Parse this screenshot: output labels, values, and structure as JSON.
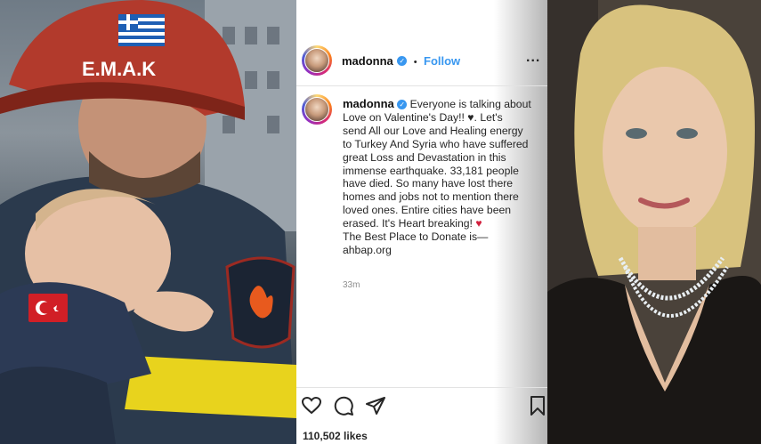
{
  "post_header": {
    "username": "madonna",
    "separator": "•",
    "follow_label": "Follow",
    "more_label": "..."
  },
  "caption": {
    "username": "madonna",
    "line1": "Everyone is talking about",
    "line2": "Love  on Valentine's Day!! ♥. Let's",
    "line3": "send All our Love and Healing  energy",
    "line4": "to Turkey And Syria who have suffered",
    "line5": "great Loss and Devastation in this",
    "line6": "immense earthquake.  33,181 people",
    "line7": "have died.  So many  have lost there",
    "line8": "homes and jobs not to mention there",
    "line9": "loved ones. Entire cities have been",
    "line10": "erased. It's Heart breaking!",
    "heart": "♥",
    "line11": "The Best Place to Donate is—",
    "line12": "ahbap.org"
  },
  "timestamp": "33m",
  "likes": "110,502 likes",
  "left_image": {
    "helmet_text": "E.M.A.K",
    "icons": [
      "greek-flag",
      "turkish-flag",
      "fire-service-patch"
    ]
  },
  "colors": {
    "follow": "#3897f0",
    "heart": "#d21f3c",
    "text": "#262626",
    "muted": "#8e8e8e"
  }
}
